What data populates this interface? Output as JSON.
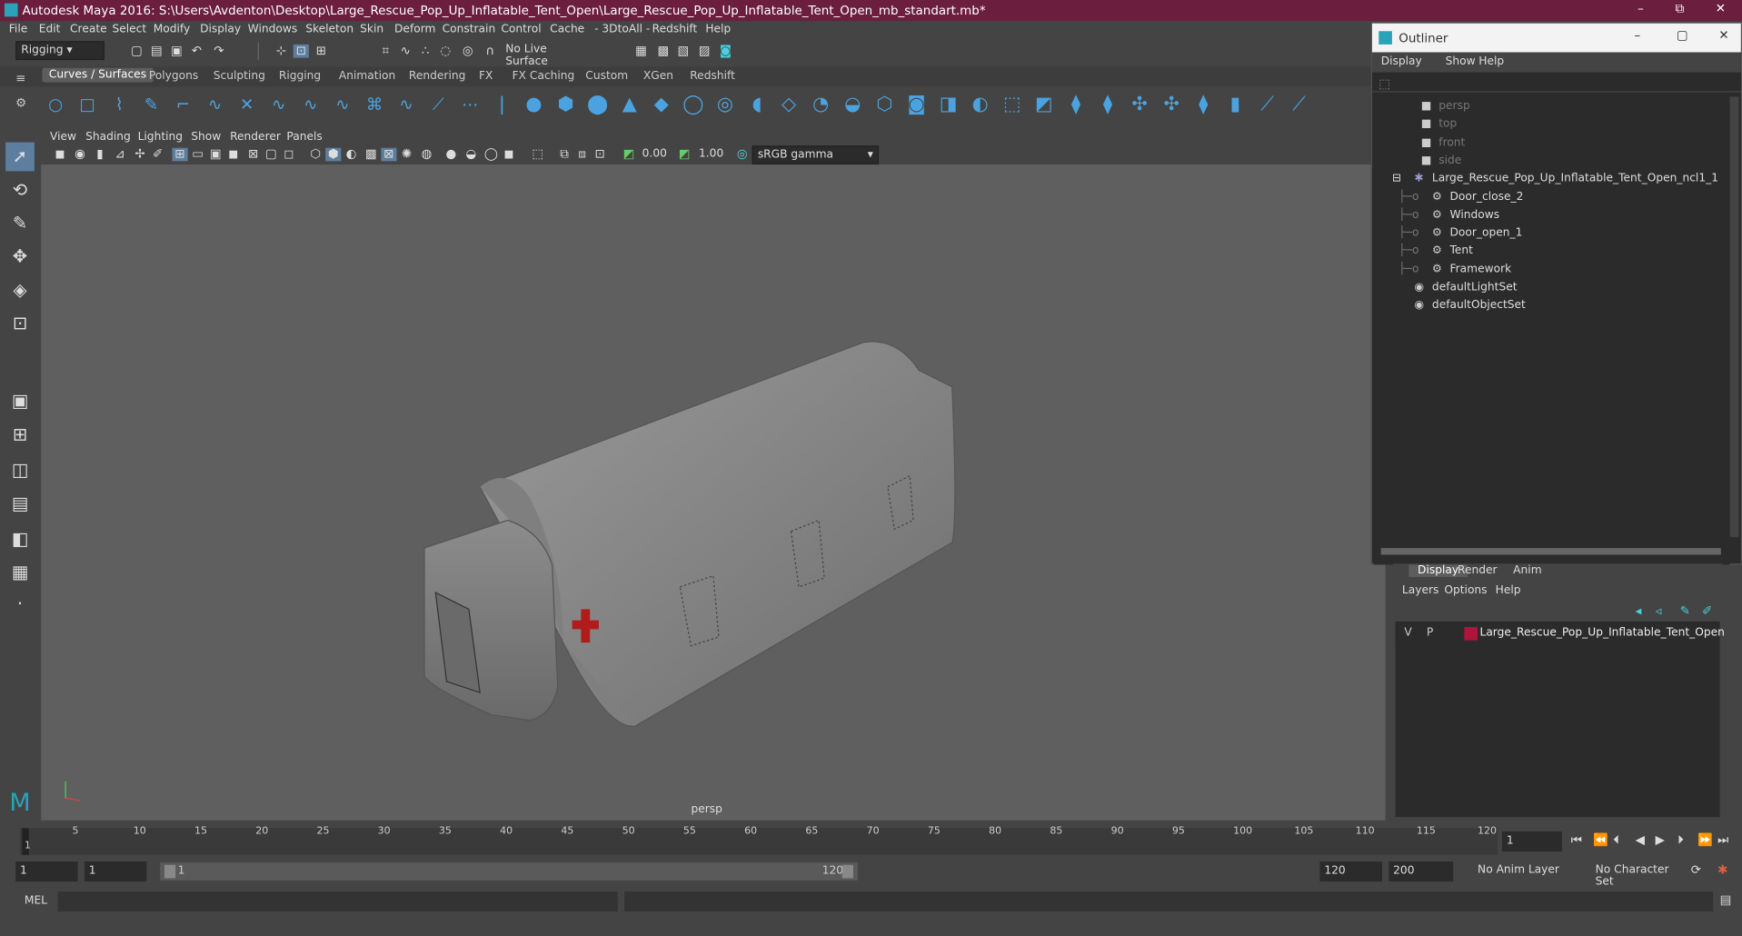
{
  "window": {
    "title": "Autodesk Maya 2016: S:\\Users\\Avdenton\\Desktop\\Large_Rescue_Pop_Up_Inflatable_Tent_Open\\Large_Rescue_Pop_Up_Inflatable_Tent_Open_mb_standart.mb*",
    "minimize": "–",
    "maximize": "⧉",
    "close": "✕"
  },
  "menu": [
    "File",
    "Edit",
    "Create",
    "Select",
    "Modify",
    "Display",
    "Windows",
    "Skeleton",
    "Skin",
    "Deform",
    "Constrain",
    "Control",
    "Cache",
    "- 3DtoAll -",
    "Redshift",
    "Help"
  ],
  "toolbar": {
    "mode": "Rigging",
    "live_surface": "No Live Surface"
  },
  "shelf_tabs": [
    "Curves / Surfaces",
    "Polygons",
    "Sculpting",
    "Rigging",
    "Animation",
    "Rendering",
    "FX",
    "FX Caching",
    "Custom",
    "XGen",
    "Redshift"
  ],
  "panel_menu": [
    "View",
    "Shading",
    "Lighting",
    "Show",
    "Renderer",
    "Panels"
  ],
  "viewport": {
    "exposure": "0.00",
    "gamma": "1.00",
    "color_space": "sRGB gamma",
    "camera": "persp"
  },
  "outliner": {
    "title": "Outliner",
    "menu": [
      "Display",
      "Show",
      "Help"
    ],
    "items": [
      {
        "label": "persp",
        "dim": true
      },
      {
        "label": "top",
        "dim": true
      },
      {
        "label": "front",
        "dim": true
      },
      {
        "label": "side",
        "dim": true
      },
      {
        "label": "Large_Rescue_Pop_Up_Inflatable_Tent_Open_ncl1_1"
      },
      {
        "label": "Door_close_2"
      },
      {
        "label": "Windows"
      },
      {
        "label": "Door_open_1"
      },
      {
        "label": "Tent"
      },
      {
        "label": "Framework"
      },
      {
        "label": "defaultLightSet"
      },
      {
        "label": "defaultObjectSet"
      }
    ]
  },
  "layer_editor": {
    "tabs": [
      "Display",
      "Render",
      "Anim"
    ],
    "menu": [
      "Layers",
      "Options",
      "Help"
    ],
    "layer": {
      "v": "V",
      "p": "P",
      "name": "Large_Rescue_Pop_Up_Inflatable_Tent_Open",
      "color": "#b0143c"
    }
  },
  "timeline": {
    "ticks": [
      "5",
      "10",
      "15",
      "20",
      "25",
      "30",
      "35",
      "40",
      "45",
      "50",
      "55",
      "60",
      "65",
      "70",
      "75",
      "80",
      "85",
      "90",
      "95",
      "100",
      "105",
      "110",
      "115",
      "120"
    ],
    "current_frame": "1",
    "current_field": "1"
  },
  "range": {
    "start": "1",
    "start2": "1",
    "slider_start": "1",
    "slider_end": "120",
    "end": "120",
    "end2": "200",
    "anim_layer": "No Anim Layer",
    "char_set": "No Character Set"
  },
  "mel": {
    "label": "MEL"
  }
}
